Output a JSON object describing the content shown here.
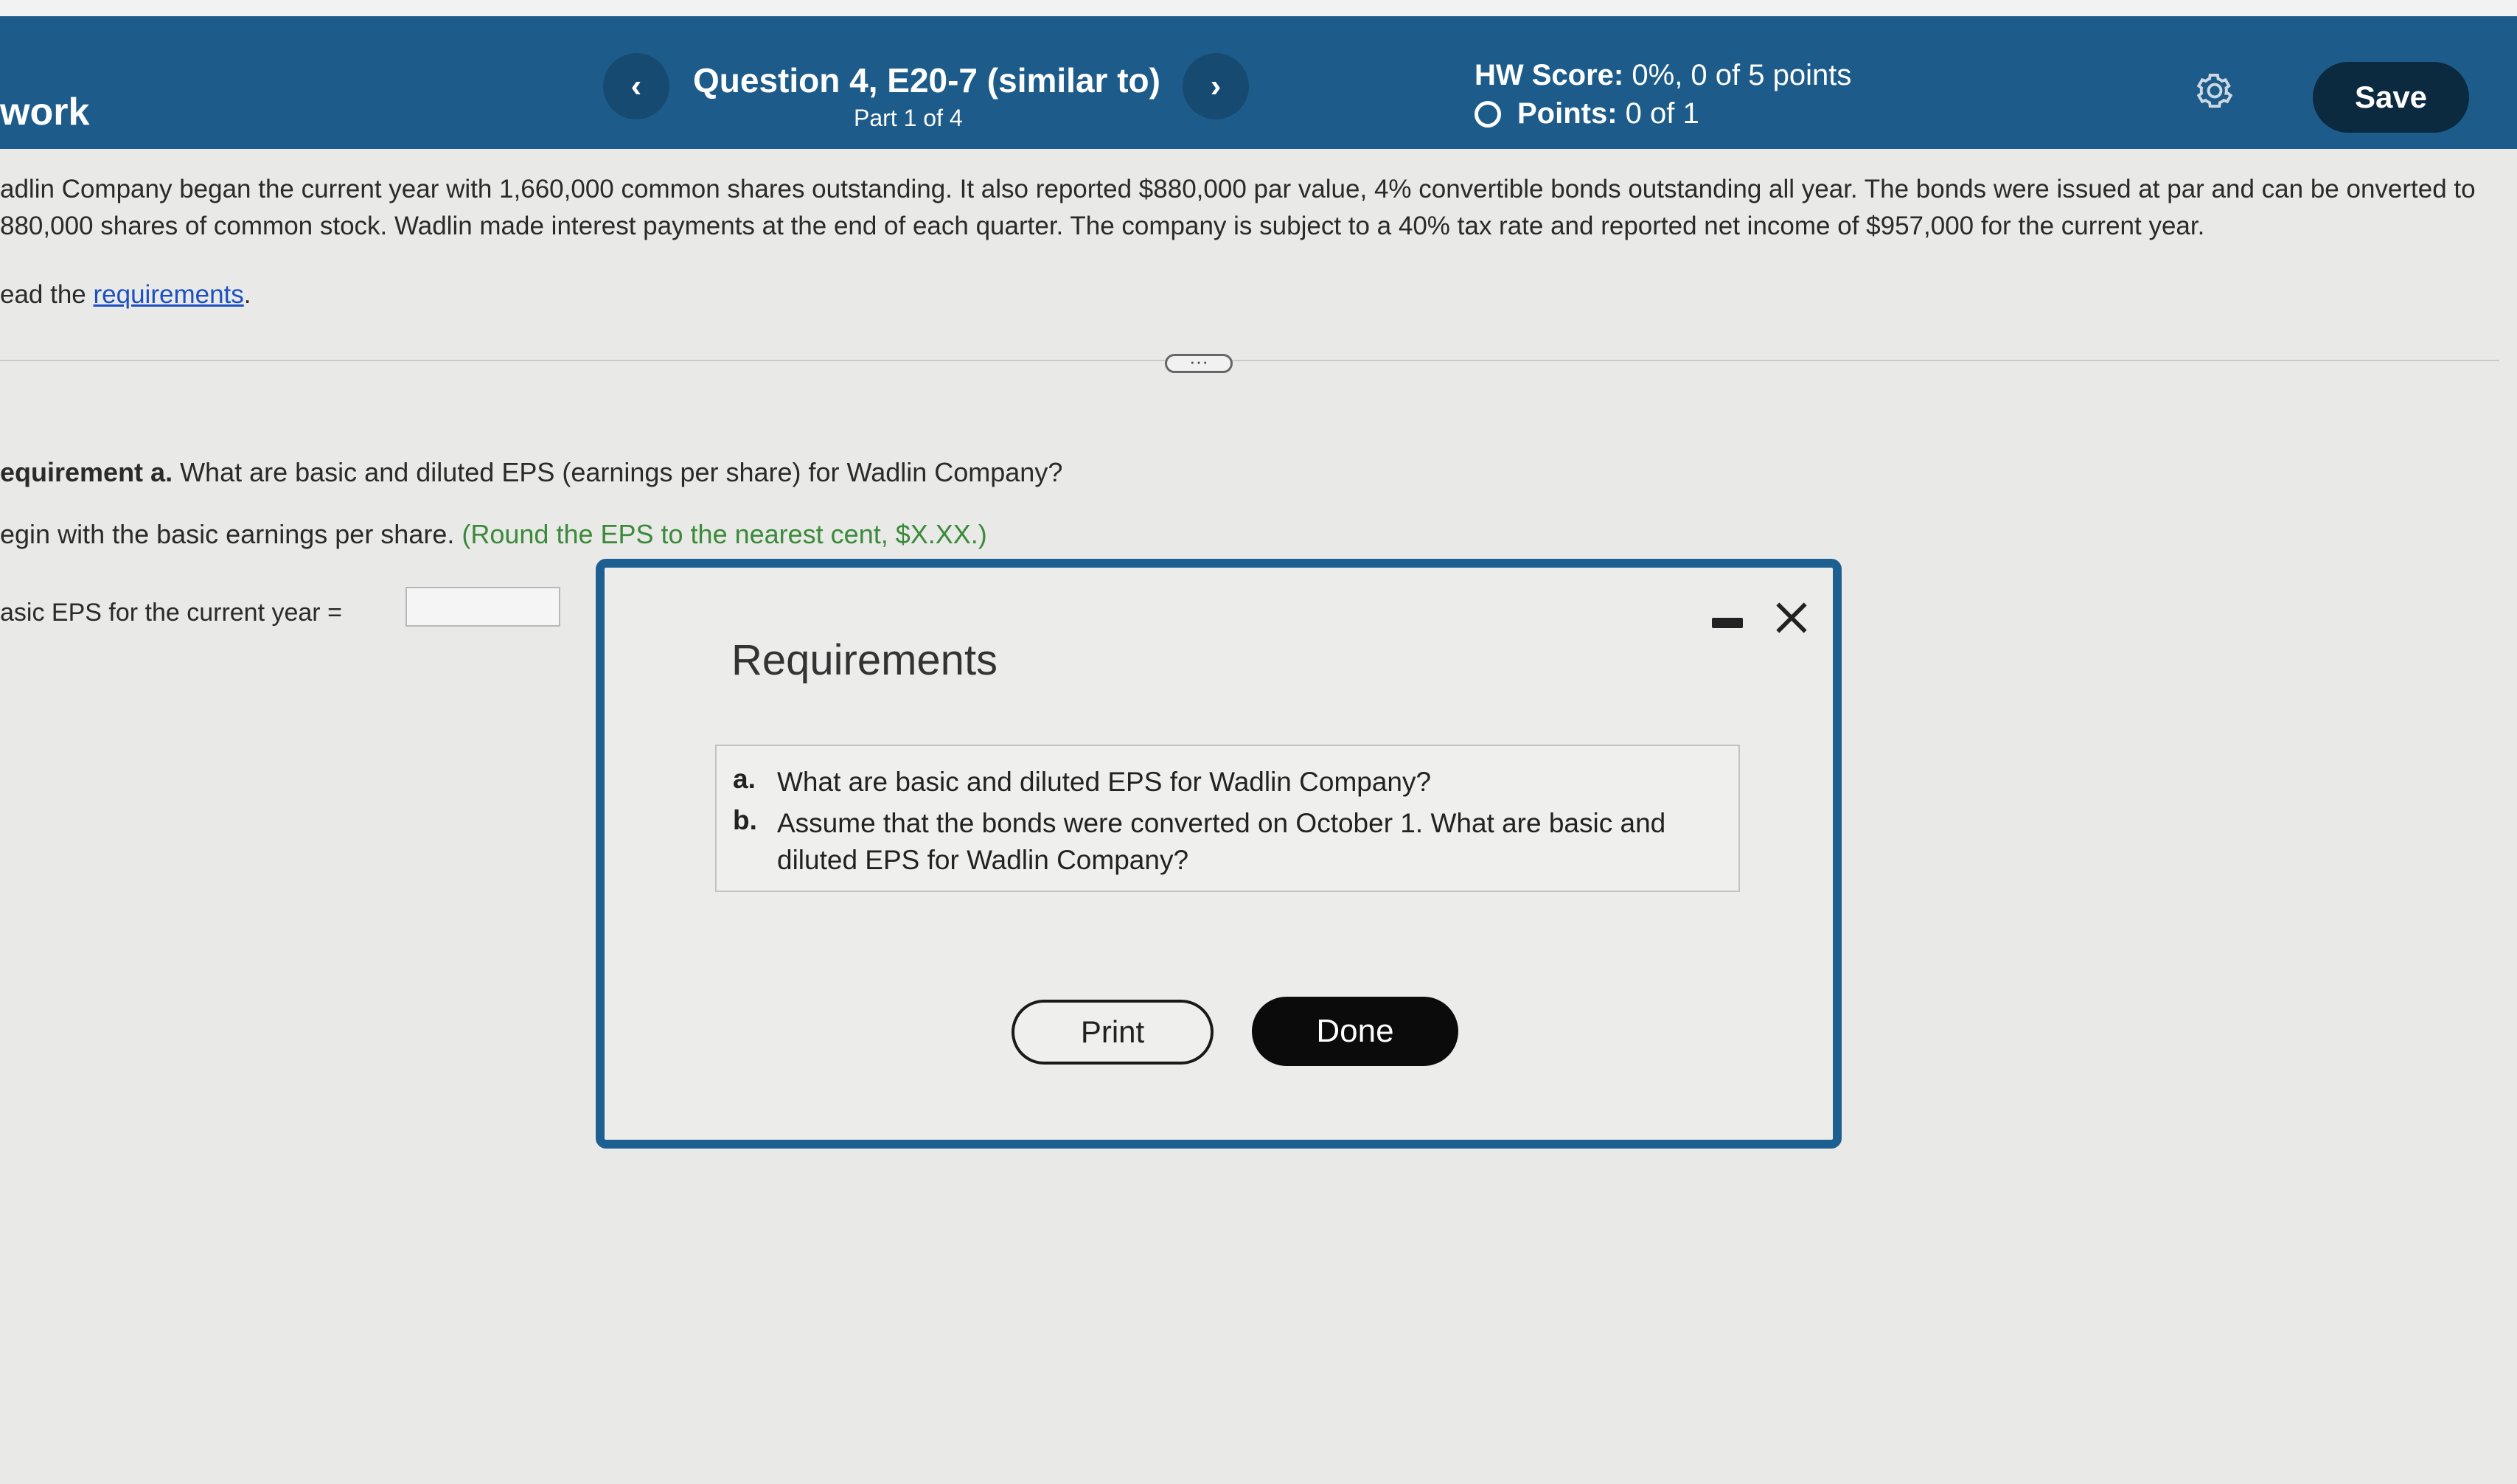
{
  "header": {
    "section_title": "work",
    "question_title": "Question 4, E20-7 (similar to)",
    "part": "Part 1 of 4",
    "prev_icon": "chevron-left-icon",
    "next_icon": "chevron-right-icon",
    "hw_score_label": "HW Score:",
    "hw_score_value": "0%, 0 of 5 points",
    "points_label": "Points:",
    "points_value": "0 of 1",
    "save_label": "Save"
  },
  "problem": {
    "text": "adlin Company began the current year with 1,660,000 common shares outstanding. It also reported $880,000 par value, 4% convertible bonds outstanding all year. The bonds were issued at par and can be onverted to 880,000 shares of common stock. Wadlin made interest payments at the end of each quarter. The company is subject to a 40% tax rate and reported net income of $957,000 for the current year.",
    "read_prefix": "ead the ",
    "read_link": "requirements",
    "read_suffix": ".",
    "more_label": "···"
  },
  "question": {
    "req_label": "equirement a.",
    "req_text": " What are basic and diluted EPS (earnings per share) for Wadlin Company?",
    "begin_text": "egin with the basic earnings per share. ",
    "hint": "(Round the EPS to the nearest cent, $X.XX.)",
    "eps_label": "asic EPS for the current year =",
    "eps_value": ""
  },
  "modal": {
    "title": "Requirements",
    "items": [
      {
        "letter": "a.",
        "text": "What are basic and diluted EPS for Wadlin Company?"
      },
      {
        "letter": "b.",
        "text": "Assume that the bonds were converted on October 1. What are basic and diluted EPS for Wadlin Company?"
      }
    ],
    "print_label": "Print",
    "done_label": "Done"
  },
  "colors": {
    "header_bg": "#1d5c8a",
    "modal_border": "#1e5f92",
    "hint_green": "#3a8a3a",
    "link_blue": "#1c4fc4"
  }
}
